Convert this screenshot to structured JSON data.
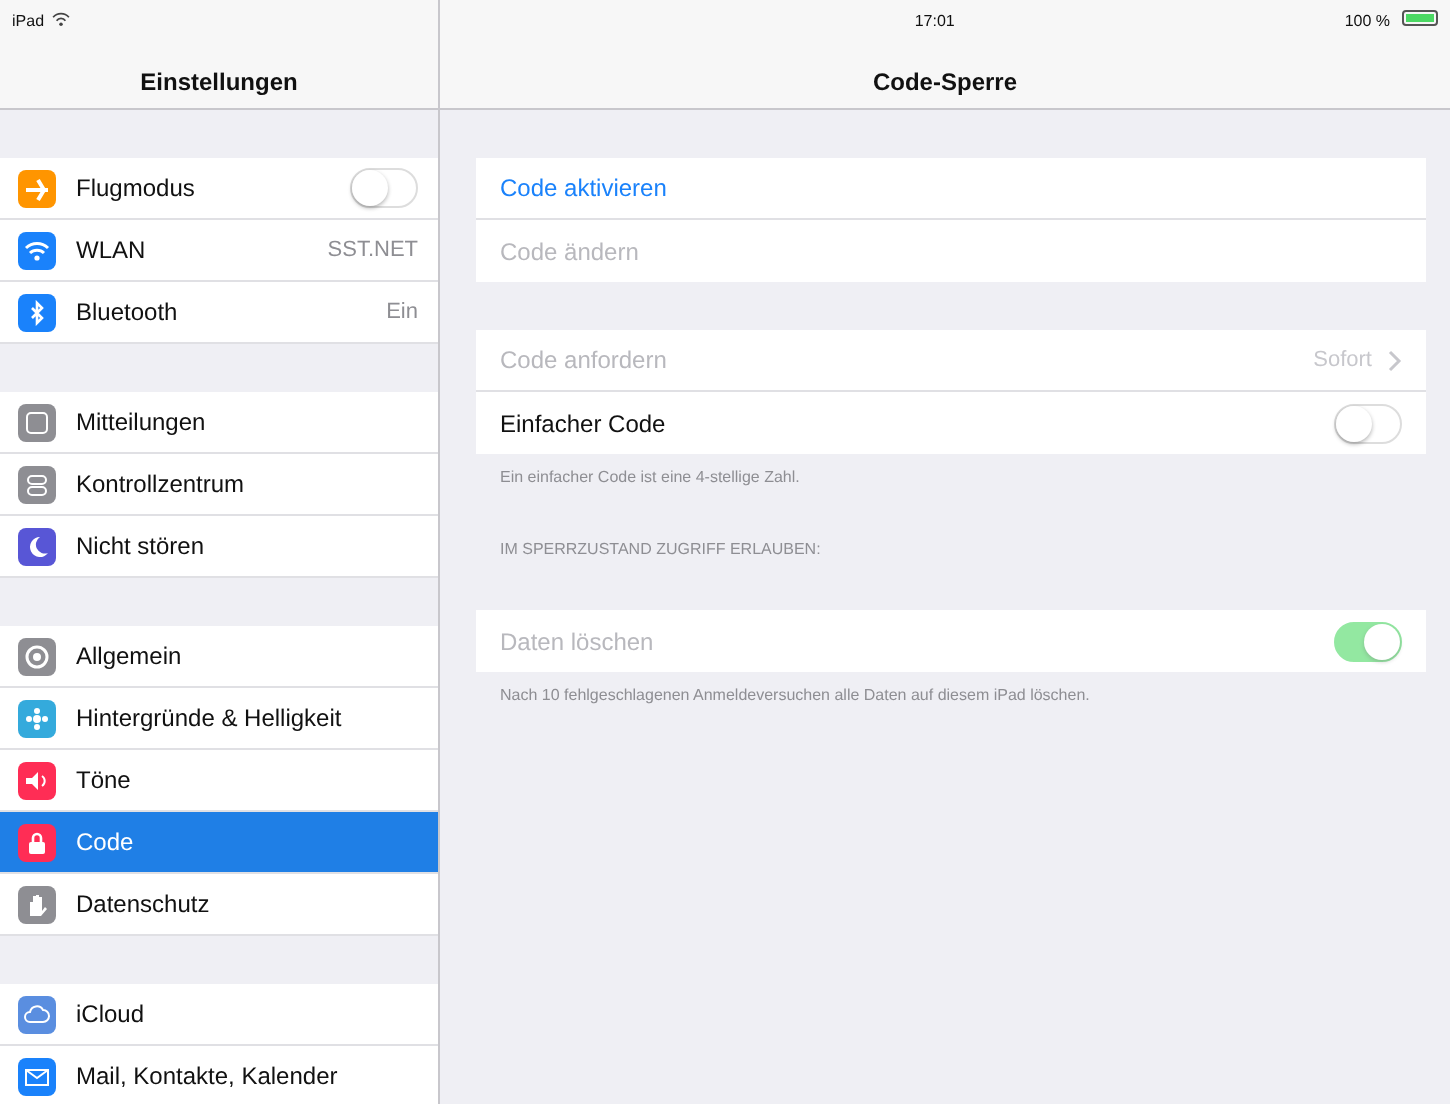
{
  "status_bar": {
    "device": "iPad",
    "time": "17:01",
    "battery": "100 %"
  },
  "sidebar": {
    "title": "Einstellungen",
    "groups": [
      [
        {
          "label": "Flugmodus",
          "color": "#ff9500",
          "kind": "switch",
          "on": false,
          "selected": false
        },
        {
          "label": "WLAN",
          "color": "#1a82fb",
          "kind": "value",
          "value": "SST.NET",
          "selected": false
        },
        {
          "label": "Bluetooth",
          "color": "#1a82fb",
          "kind": "value",
          "value": "Ein",
          "selected": false
        }
      ],
      [
        {
          "label": "Mitteilungen",
          "color": "#8e8e93",
          "kind": "plain",
          "selected": false
        },
        {
          "label": "Kontrollzentrum",
          "color": "#8e8e93",
          "kind": "plain",
          "selected": false
        },
        {
          "label": "Nicht stören",
          "color": "#5856d6",
          "kind": "plain",
          "selected": false
        }
      ],
      [
        {
          "label": "Allgemein",
          "color": "#8e8e93",
          "kind": "plain",
          "selected": false
        },
        {
          "label": "Hintergründe & Helligkeit",
          "color": "#34aadc",
          "kind": "plain",
          "selected": false
        },
        {
          "label": "Töne",
          "color": "#ff2d55",
          "kind": "plain",
          "selected": false
        },
        {
          "label": "Code",
          "color": "#ff2d55",
          "kind": "plain",
          "selected": true
        },
        {
          "label": "Datenschutz",
          "color": "#8e8e93",
          "kind": "plain",
          "selected": false
        }
      ],
      [
        {
          "label": "iCloud",
          "color": "#5a8ee0",
          "kind": "plain",
          "selected": false
        },
        {
          "label": "Mail, Kontakte, Kalender",
          "color": "#1a82fb",
          "kind": "plain",
          "selected": false
        }
      ]
    ]
  },
  "detail": {
    "title": "Code-Sperre",
    "sections": [
      {
        "rows": [
          {
            "label": "Code aktivieren",
            "kind": "action",
            "disabled": false
          },
          {
            "label": "Code ändern",
            "kind": "action",
            "disabled": true
          }
        ]
      },
      {
        "rows": [
          {
            "label": "Code anfordern",
            "kind": "value",
            "value": "Sofort",
            "disabled": true
          },
          {
            "label": "Einfacher Code",
            "kind": "switch",
            "on": false,
            "disabled": false
          }
        ],
        "footer": "Ein einfacher Code ist eine 4-stellige Zahl."
      },
      {
        "header": "IM SPERRZUSTAND ZUGRIFF ERLAUBEN:"
      },
      {
        "rows": [
          {
            "label": "Daten löschen",
            "kind": "switch",
            "on": true,
            "disabled": true
          }
        ],
        "footer": "Nach 10 fehlgeschlagenen Anmeldeversuchen alle Daten auf diesem iPad löschen."
      }
    ]
  }
}
